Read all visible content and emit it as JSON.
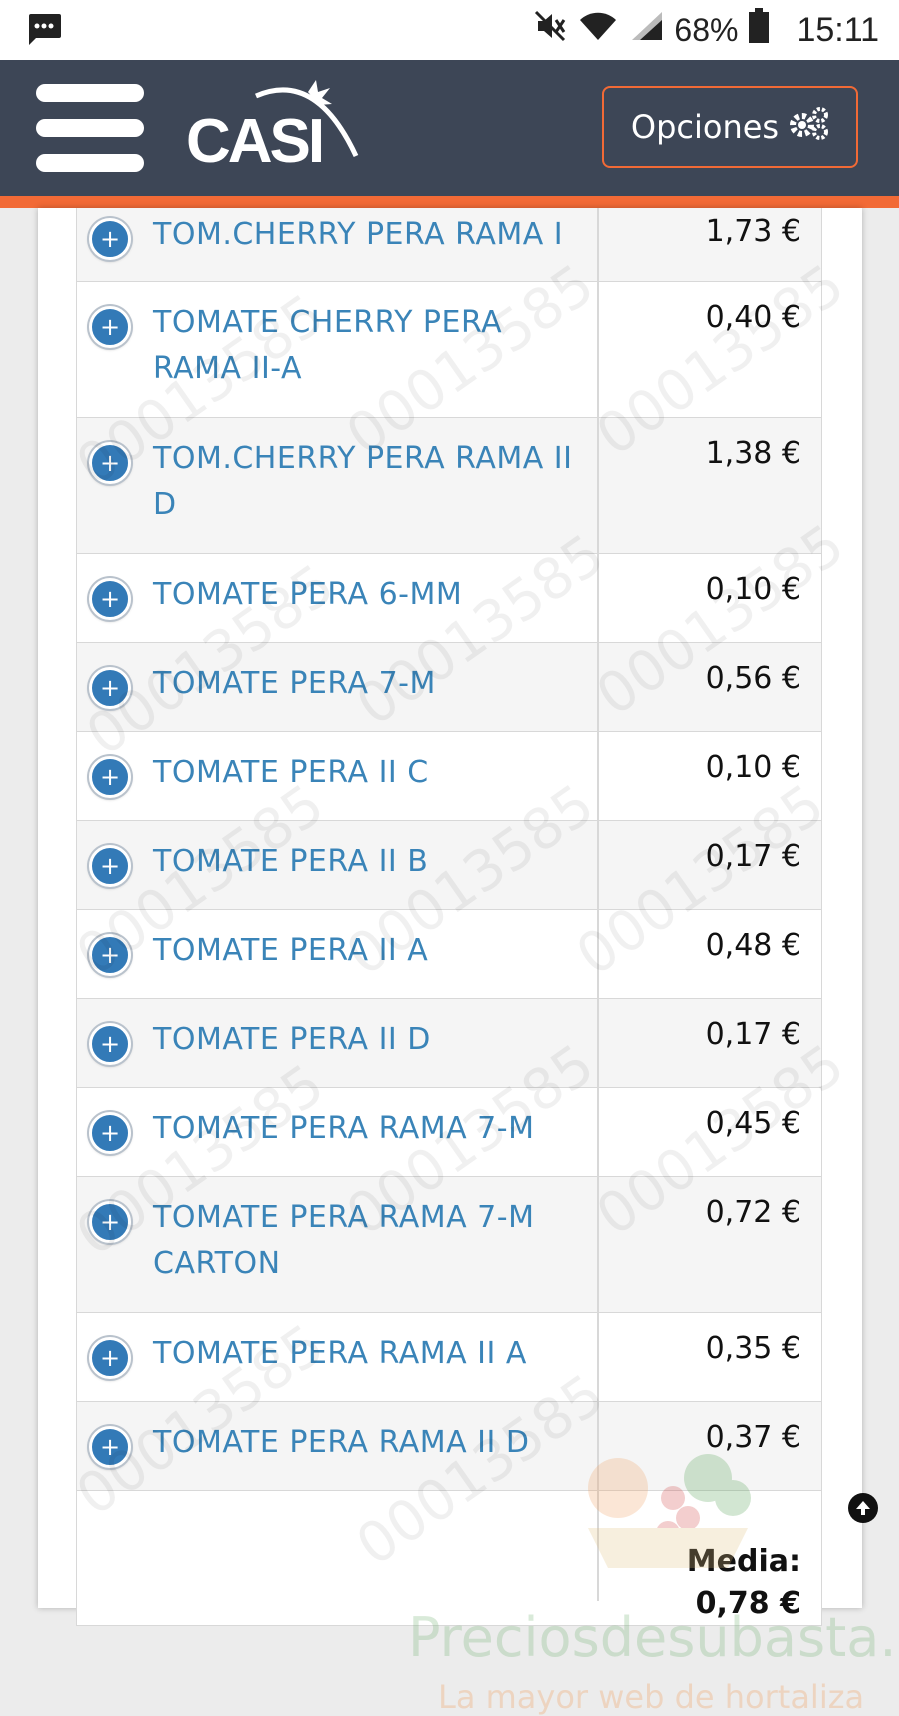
{
  "status_bar": {
    "battery": "68%",
    "time": "15:11"
  },
  "header": {
    "logo_text": "CASI",
    "options_label": "Opciones"
  },
  "products": [
    {
      "name": "TOM.CHERRY PERA RAMA I",
      "price": "1,73 €"
    },
    {
      "name": "TOMATE CHERRY PERA RAMA II-A",
      "price": "0,40 €"
    },
    {
      "name": "TOM.CHERRY PERA RAMA II D",
      "price": "1,38 €"
    },
    {
      "name": "TOMATE PERA 6-MM",
      "price": "0,10 €"
    },
    {
      "name": "TOMATE PERA 7-M",
      "price": "0,56 €"
    },
    {
      "name": "TOMATE PERA II C",
      "price": "0,10 €"
    },
    {
      "name": "TOMATE PERA II B",
      "price": "0,17 €"
    },
    {
      "name": "TOMATE PERA II A",
      "price": "0,48 €"
    },
    {
      "name": "TOMATE PERA II D",
      "price": "0,17 €"
    },
    {
      "name": "TOMATE PERA RAMA 7-M",
      "price": "0,45 €"
    },
    {
      "name": "TOMATE PERA RAMA 7-M CARTON",
      "price": "0,72 €"
    },
    {
      "name": "TOMATE PERA RAMA II A",
      "price": "0,35 €"
    },
    {
      "name": "TOMATE PERA RAMA II D",
      "price": "0,37 €"
    }
  ],
  "summary": {
    "label": "Media:",
    "value": "0,78 €"
  },
  "watermark": {
    "code": "00013585",
    "site": "Preciosdesubasta.com",
    "tagline": "La mayor web de hortaliza"
  },
  "colors": {
    "header_bg": "#3d4656",
    "accent": "#f26a36",
    "link": "#3a84b8",
    "plus_button": "#337ab7"
  }
}
